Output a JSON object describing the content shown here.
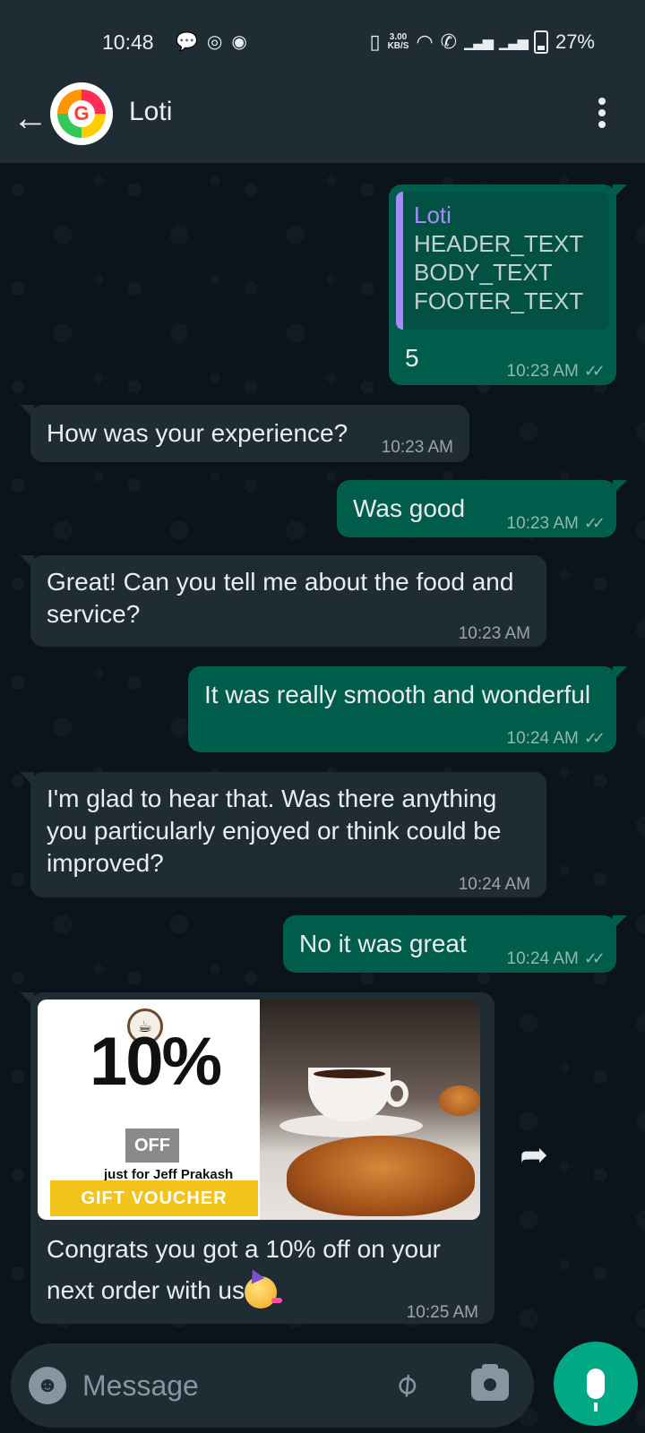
{
  "status_bar": {
    "time": "10:48",
    "left_icons": [
      "chat-icon",
      "instagram-icon",
      "reddit-icon"
    ],
    "network_speed_value": "3.00",
    "network_speed_unit": "KB/S",
    "battery": "27%"
  },
  "header": {
    "contact_name": "Loti",
    "avatar_letter": "G"
  },
  "messages": [
    {
      "direction": "outgoing",
      "quote": {
        "name": "Loti",
        "lines": [
          "HEADER_TEXT",
          "BODY_TEXT",
          "FOOTER_TEXT"
        ]
      },
      "text": "5",
      "time": "10:23 AM",
      "status": "read"
    },
    {
      "direction": "incoming",
      "text": "How was your experience?",
      "time": "10:23 AM"
    },
    {
      "direction": "outgoing",
      "text": "Was good",
      "time": "10:23 AM",
      "status": "read"
    },
    {
      "direction": "incoming",
      "text": "Great! Can you tell me about the food and service?",
      "time": "10:23 AM"
    },
    {
      "direction": "outgoing",
      "text": "It was really smooth and wonderful",
      "time": "10:24 AM",
      "status": "read"
    },
    {
      "direction": "incoming",
      "text": "I'm glad to hear that. Was there anything you particularly enjoyed or think could be improved?",
      "time": "10:24 AM"
    },
    {
      "direction": "outgoing",
      "text": "No it was great",
      "time": "10:24 AM",
      "status": "read"
    },
    {
      "direction": "incoming",
      "image": {
        "percent": "10%",
        "off": "OFF",
        "for_text": "just for Jeff Prakash",
        "gift_label": "GIFT VOUCHER"
      },
      "text": "Congrats you got a 10% off on your next order with us",
      "time": "10:25 AM"
    }
  ],
  "input_bar": {
    "placeholder": "Message"
  },
  "colors": {
    "outgoing_bubble": "#005c4b",
    "incoming_bubble": "#202c33",
    "accent": "#00a884"
  }
}
